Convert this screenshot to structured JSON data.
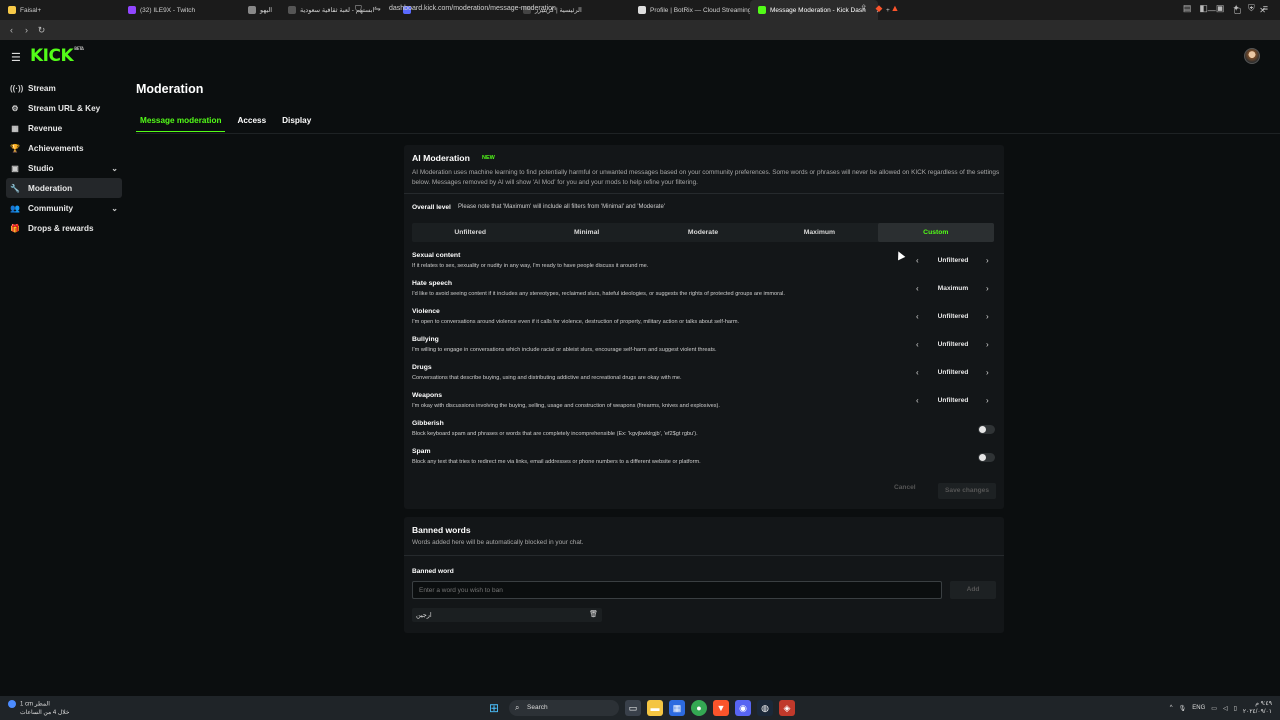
{
  "browser": {
    "tabs": [
      {
        "label": "Faisal+",
        "color": "#f7c948",
        "active": false
      },
      {
        "label": "(32) ILE9X - Twitch",
        "color": "#9146ff",
        "active": false
      },
      {
        "label": "اليهو",
        "color": "#888888",
        "active": false
      },
      {
        "label": "ابستهم - لعبة ثقافية سعودية",
        "color": "#555555",
        "active": false
      },
      {
        "label": "",
        "color": "#5a6aff",
        "active": false
      },
      {
        "label": "الرئيسية | كريتيرز",
        "color": "#444444",
        "active": false
      },
      {
        "label": "Profile | BotRix — Cloud Streaming B",
        "color": "#dddddd",
        "active": false
      },
      {
        "label": "Message Moderation - Kick Dash",
        "color": "#53fc18",
        "active": true
      }
    ],
    "new_tab": "+",
    "url": "dashboard.kick.com/moderation/message-moderation"
  },
  "header": {
    "logo": "KICK",
    "beta": "BETA"
  },
  "sidebar": {
    "items": [
      {
        "label": "Stream",
        "icon": "((·))",
        "chevron": false,
        "active": false
      },
      {
        "label": "Stream URL & Key",
        "icon": "⚙",
        "chevron": false,
        "active": false
      },
      {
        "label": "Revenue",
        "icon": "▦",
        "chevron": false,
        "active": false
      },
      {
        "label": "Achievements",
        "icon": "🏆",
        "chevron": false,
        "active": false
      },
      {
        "label": "Studio",
        "icon": "▣",
        "chevron": true,
        "active": false
      },
      {
        "label": "Moderation",
        "icon": "🔧",
        "chevron": false,
        "active": true
      },
      {
        "label": "Community",
        "icon": "👥",
        "chevron": true,
        "active": false
      },
      {
        "label": "Drops & rewards",
        "icon": "🎁",
        "chevron": false,
        "active": false
      }
    ]
  },
  "page": {
    "title": "Moderation",
    "tabs": [
      {
        "label": "Message moderation",
        "active": true
      },
      {
        "label": "Access",
        "active": false
      },
      {
        "label": "Display",
        "active": false
      }
    ]
  },
  "ai": {
    "title": "AI Moderation",
    "badge": "NEW",
    "description": "AI Moderation uses machine learning to find potentially harmful or unwanted messages based on your community preferences. Some words or phrases will never be allowed on KICK regardless of the settings below. Messages removed by AI will show 'AI Mod' for you and your mods to help refine your filtering.",
    "overall_label": "Overall level",
    "overall_note": "Please note that 'Maximum' will include all filters from 'Minimal' and 'Moderate'",
    "levels": [
      {
        "label": "Unfiltered",
        "active": false
      },
      {
        "label": "Minimal",
        "active": false
      },
      {
        "label": "Moderate",
        "active": false
      },
      {
        "label": "Maximum",
        "active": false
      },
      {
        "label": "Custom",
        "active": true
      }
    ],
    "categories": [
      {
        "name": "Sexual content",
        "desc": "If it relates to sex, sexuality or nudity in any way, I'm ready to have people discuss it around me.",
        "value": "Unfiltered"
      },
      {
        "name": "Hate speech",
        "desc": "I'd like to avoid seeing content if it includes any stereotypes, reclaimed slurs, hateful ideologies, or suggests the rights of protected groups are immoral.",
        "value": "Maximum"
      },
      {
        "name": "Violence",
        "desc": "I'm open to conversations around violence even if it calls for violence, destruction of property, military action or talks about self-harm.",
        "value": "Unfiltered"
      },
      {
        "name": "Bullying",
        "desc": "I'm willing to engage in conversations which include racial or ableist slurs, encourage self-harm and suggest violent threats.",
        "value": "Unfiltered"
      },
      {
        "name": "Drugs",
        "desc": "Conversations that describe buying, using and distributing addictive and recreational drugs are okay with me.",
        "value": "Unfiltered"
      },
      {
        "name": "Weapons",
        "desc": "I'm okay with discussions involving the buying, selling, usage and construction of weapons (firearms, knives and explosives).",
        "value": "Unfiltered"
      }
    ],
    "toggles": [
      {
        "name": "Gibberish",
        "desc": "Block keyboard spam and phrases or words that are completely incomprehensible (Ex: 'kgvjbwklrgjb', 'ef2$gt rgbu').",
        "on": false
      },
      {
        "name": "Spam",
        "desc": "Block any text that tries to redirect me via links, email addresses or phone numbers to a different website or platform.",
        "on": false
      }
    ],
    "cancel": "Cancel",
    "save": "Save changes"
  },
  "banned": {
    "title": "Banned words",
    "description": "Words added here will be automatically blocked in your chat.",
    "field_label": "Banned word",
    "placeholder": "Enter a word you wish to ban",
    "add": "Add",
    "words": [
      "ارجين"
    ]
  },
  "taskbar": {
    "weather_line1": "1 cm المطر",
    "weather_line2": "خلال 4 من الساعات",
    "search": "Search",
    "lang": "ENG",
    "time": "٩:٤٩ م",
    "date": "٢٠٢٤/٠٩/٠١"
  }
}
